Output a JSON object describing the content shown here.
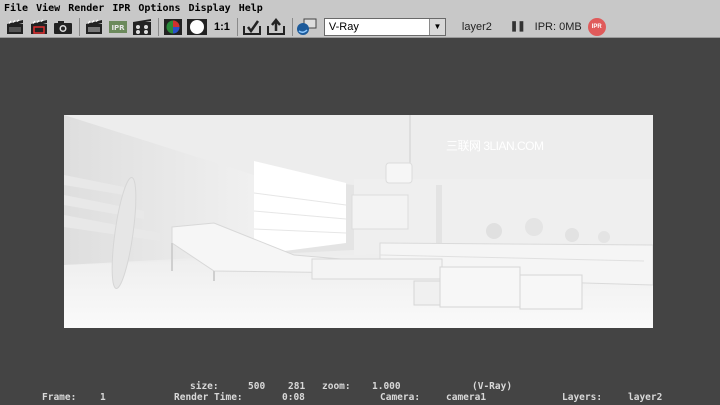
{
  "menu": [
    "File",
    "View",
    "Render",
    "IPR",
    "Options",
    "Display",
    "Help"
  ],
  "toolbar": {
    "one_to_one_label": "1:1",
    "renderer_value": "V-Ray",
    "layer_label": "layer2",
    "ipr_status": "IPR: 0MB",
    "ipr_badge": "IPR",
    "icons": [
      "render-clapper-icon",
      "render-region-icon",
      "snapshot-camera-icon",
      "redo-render-icon",
      "ipr-render-icon",
      "batch-render-icon",
      "color-channels-icon",
      "alpha-channel-icon",
      "keep-image-icon",
      "remove-image-icon",
      "render-settings-icon"
    ]
  },
  "render": {
    "watermark": "三联网 3LIAN.COM"
  },
  "status": {
    "size_label": "size:",
    "width": "500",
    "height": "281",
    "zoom_label": "zoom:",
    "zoom": "1.000",
    "renderer": "(V-Ray)",
    "frame_label": "Frame:",
    "frame": "1",
    "render_time_label": "Render Time:",
    "render_time": "0:08",
    "camera_label": "Camera:",
    "camera": "camera1",
    "layers_label": "Layers:",
    "layers": "layer2"
  },
  "colors": {
    "background": "#444444",
    "toolbar": "#c8c8c8",
    "status_text": "#d8d8d8",
    "ipr_badge": "#e05a5a"
  }
}
